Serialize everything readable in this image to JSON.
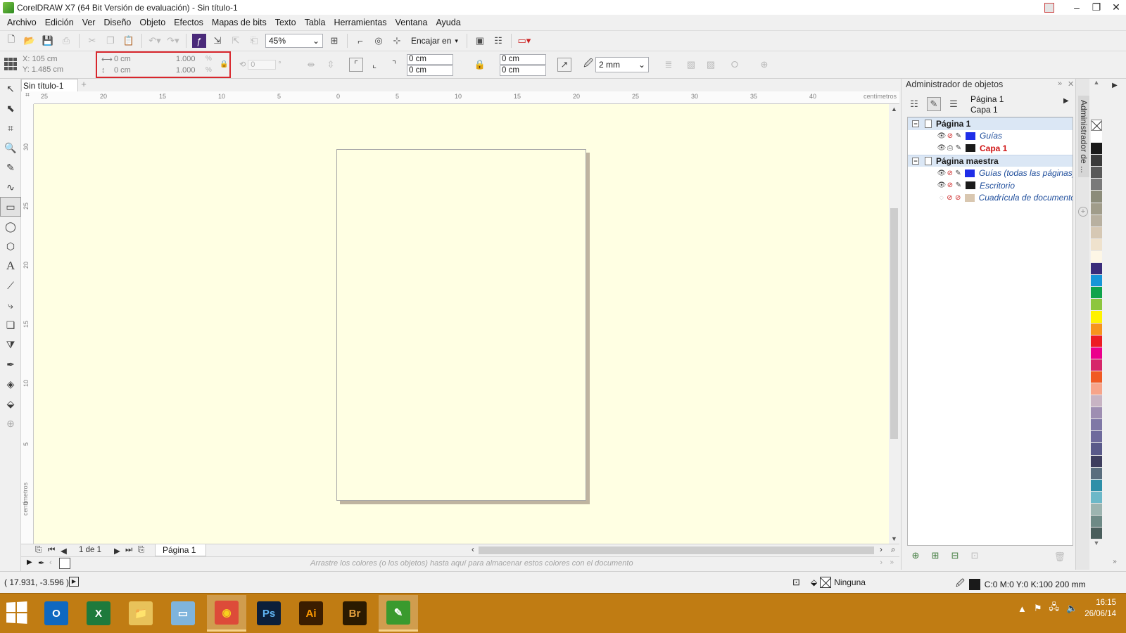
{
  "window": {
    "title": "CorelDRAW X7 (64 Bit Versión de evaluación) - Sin título-1",
    "minimize": "–",
    "maximize": "❐",
    "close": "✕"
  },
  "menu": [
    "Archivo",
    "Edición",
    "Ver",
    "Diseño",
    "Objeto",
    "Efectos",
    "Mapas de bits",
    "Texto",
    "Tabla",
    "Herramientas",
    "Ventana",
    "Ayuda"
  ],
  "toolbar": {
    "zoom_value": "45%",
    "snap_label": "Encajar en"
  },
  "property_bar": {
    "x": "X: 105 cm",
    "y": "Y: 1.485 cm",
    "width": "0 cm",
    "height": "0 cm",
    "scale_x": "1.000",
    "scale_y": "1.000",
    "pct_x": "%",
    "pct_y": "%",
    "rotation": "0",
    "rotation_unit": "°",
    "corner_1": "0 cm",
    "corner_2": "0 cm",
    "corner_3": "0 cm",
    "corner_4": "0 cm",
    "outline_width": "2 mm"
  },
  "document": {
    "tab_label": "Sin título-1",
    "ruler_unit": "centímetros",
    "ruler_h_labels": [
      "25",
      "20",
      "15",
      "10",
      "5",
      "0",
      "5",
      "10",
      "15",
      "20",
      "25",
      "30",
      "35",
      "40"
    ],
    "ruler_v_labels": [
      "30",
      "25",
      "20",
      "15",
      "10",
      "5",
      "0"
    ],
    "page_count": "1 de 1",
    "page_tab": "Página 1",
    "palette_hint": "Arrastre los colores (o los objetos) hasta aquí para almacenar estos colores con el documento"
  },
  "object_manager": {
    "title": "Administrador de objetos",
    "current_page": "Página 1",
    "current_layer": "Capa 1",
    "side_tab": "Administrador de ...",
    "tree": [
      {
        "type": "group",
        "label": "Página 1"
      },
      {
        "type": "layer",
        "label": "Guías",
        "color": "#1f2ee8",
        "active": false
      },
      {
        "type": "layer",
        "label": "Capa 1",
        "color": "#1a1a1a",
        "active": true
      },
      {
        "type": "group",
        "label": "Página maestra"
      },
      {
        "type": "layer",
        "label": "Guías (todas las páginas)",
        "color": "#1f2ee8",
        "active": false
      },
      {
        "type": "layer",
        "label": "Escritorio",
        "color": "#1a1a1a",
        "active": false
      },
      {
        "type": "layer",
        "label": "Cuadrícula de documento",
        "color": "#d9c7b0",
        "active": false
      }
    ]
  },
  "palette_colors": [
    "#ffffff",
    "#1a1a1a",
    "#3a3a3a",
    "#595959",
    "#7a7a7a",
    "#8c8c7a",
    "#a09c8a",
    "#b8b0a0",
    "#d6c8b4",
    "#efe2cd",
    "#fdf6e6",
    "#3a2c7a",
    "#1696d8",
    "#0fa34b",
    "#8dc63f",
    "#fff200",
    "#f7941d",
    "#ed1c24",
    "#ec008c",
    "#d6266a",
    "#f15a24",
    "#f7a48a",
    "#c8b4c4",
    "#9e8eb2",
    "#7f78a6",
    "#6e6a9c",
    "#5a5a8a",
    "#3e3e5e",
    "#5a6e7e",
    "#2e8fa8",
    "#6cb8c8",
    "#9cb4b0",
    "#6e8a86",
    "#4a5e5c"
  ],
  "status": {
    "coords": "( 17.931, -3.596 )",
    "fill_label": "Ninguna",
    "outline_info": "C:0 M:0 Y:0 K:100  200 mm"
  },
  "taskbar": {
    "time": "16:15",
    "date": "26/06/14",
    "apps": [
      {
        "name": "outlook",
        "text": "O",
        "bg": "#0f68c0",
        "fg": "#ffffff"
      },
      {
        "name": "excel",
        "text": "X",
        "bg": "#1e7a3c",
        "fg": "#ffffff"
      },
      {
        "name": "file-explorer",
        "text": "📁",
        "bg": "#e8c25a",
        "fg": "#5a3a00"
      },
      {
        "name": "ie-window",
        "text": "▭",
        "bg": "#7fb4dc",
        "fg": "#ffffff"
      },
      {
        "name": "chrome",
        "text": "◉",
        "bg": "#dd4b39",
        "fg": "#f7d21e"
      },
      {
        "name": "photoshop",
        "text": "Ps",
        "bg": "#0c1f3a",
        "fg": "#5fb3f2"
      },
      {
        "name": "illustrator",
        "text": "Ai",
        "bg": "#3b1d00",
        "fg": "#ff9a00"
      },
      {
        "name": "bridge",
        "text": "Br",
        "bg": "#2a1a00",
        "fg": "#e7a33e"
      },
      {
        "name": "coreldraw",
        "text": "✎",
        "bg": "#3a9a2e",
        "fg": "#ffffff"
      }
    ]
  }
}
